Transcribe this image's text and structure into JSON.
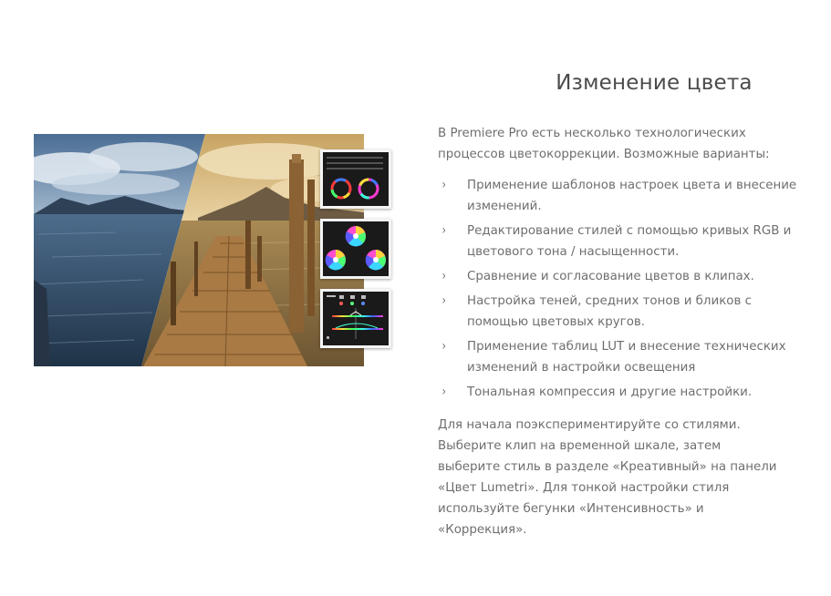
{
  "section": {
    "title": "Изменение цвета",
    "intro": "В Premiere Pro есть несколько технологических процессов цветокоррекции. Возможные варианты:",
    "bullets": [
      "Применение шаблонов настроек цвета и внесение изменений.",
      "Редактирование стилей с помощью кривых RGB и цветового тона / насыщенности.",
      "Сравнение и согласование цветов в клипах.",
      "Настройка теней, средних тонов и бликов с помощью цветовых кругов.",
      "Применение таблиц LUT и внесение технических изменений в настройки освещения",
      "Тональная компрессия и другие настройки."
    ],
    "outro": "Для начала поэкспериментируйте со стилями. Выберите клип на временной шкале, затем выберите стиль в разделе «Креативный» на панели «Цвет Lumetri». Для тонкой настройки стиля используйте бегунки «Интенсивность» и «Коррекция»."
  },
  "icons": {
    "bullet": "chevron-right-icon"
  },
  "colors": {
    "title": "#4b4b4b",
    "text": "#6e6e6e",
    "background": "#ffffff"
  }
}
